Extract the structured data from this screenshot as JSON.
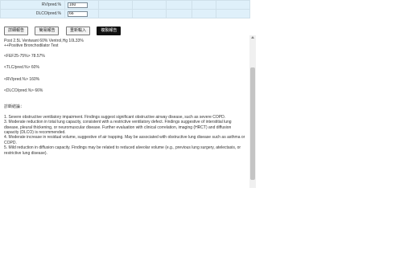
{
  "table": {
    "rows": [
      {
        "label": "RV/pred.%",
        "value": "160"
      },
      {
        "label": "DLCO/pred.%",
        "value": "66"
      }
    ]
  },
  "buttons": [
    {
      "label": "詳細報告",
      "active": false
    },
    {
      "label": "簡易報告",
      "active": false
    },
    {
      "label": "重新輸入",
      "active": false
    },
    {
      "label": "複製報告",
      "active": true
    }
  ],
  "report": {
    "top_lines": [
      "Post 2.5L Ventwant 60% Ventrol,Hg 10L33%",
      "++Positive Bronchodilator Test"
    ],
    "findings": [
      "<FEF25-75%> 78.57%",
      "<TLC/pred.%> 60%",
      "<RV/pred.%> 160%",
      "<DLCO/pred.%> 66%"
    ],
    "heading": "診斷結論：",
    "conclusions": [
      "1. Severe obstructive ventilatory impairment. Findings suggest significant obstructive airway disease, such as severe COPD.",
      "3. Moderate reduction in total lung capacity, consistent with a restrictive ventilatory defect. Findings suggestive of interstitial lung disease, pleural thickening, or neuromuscular disease. Further evaluation with clinical correlation, imaging (HRCT) and diffusion capacity (DLCO) is recommended.",
      "4. Moderate increase in residual volume, suggestive of air trapping. May be associated with obstructive lung disease such as asthma or COPD.",
      "5. Mild reduction in diffusion capacity. Findings may be related to reduced alveolar volume (e.g., previous lung surgery, atelectasis, or restrictive lung disease)."
    ]
  }
}
